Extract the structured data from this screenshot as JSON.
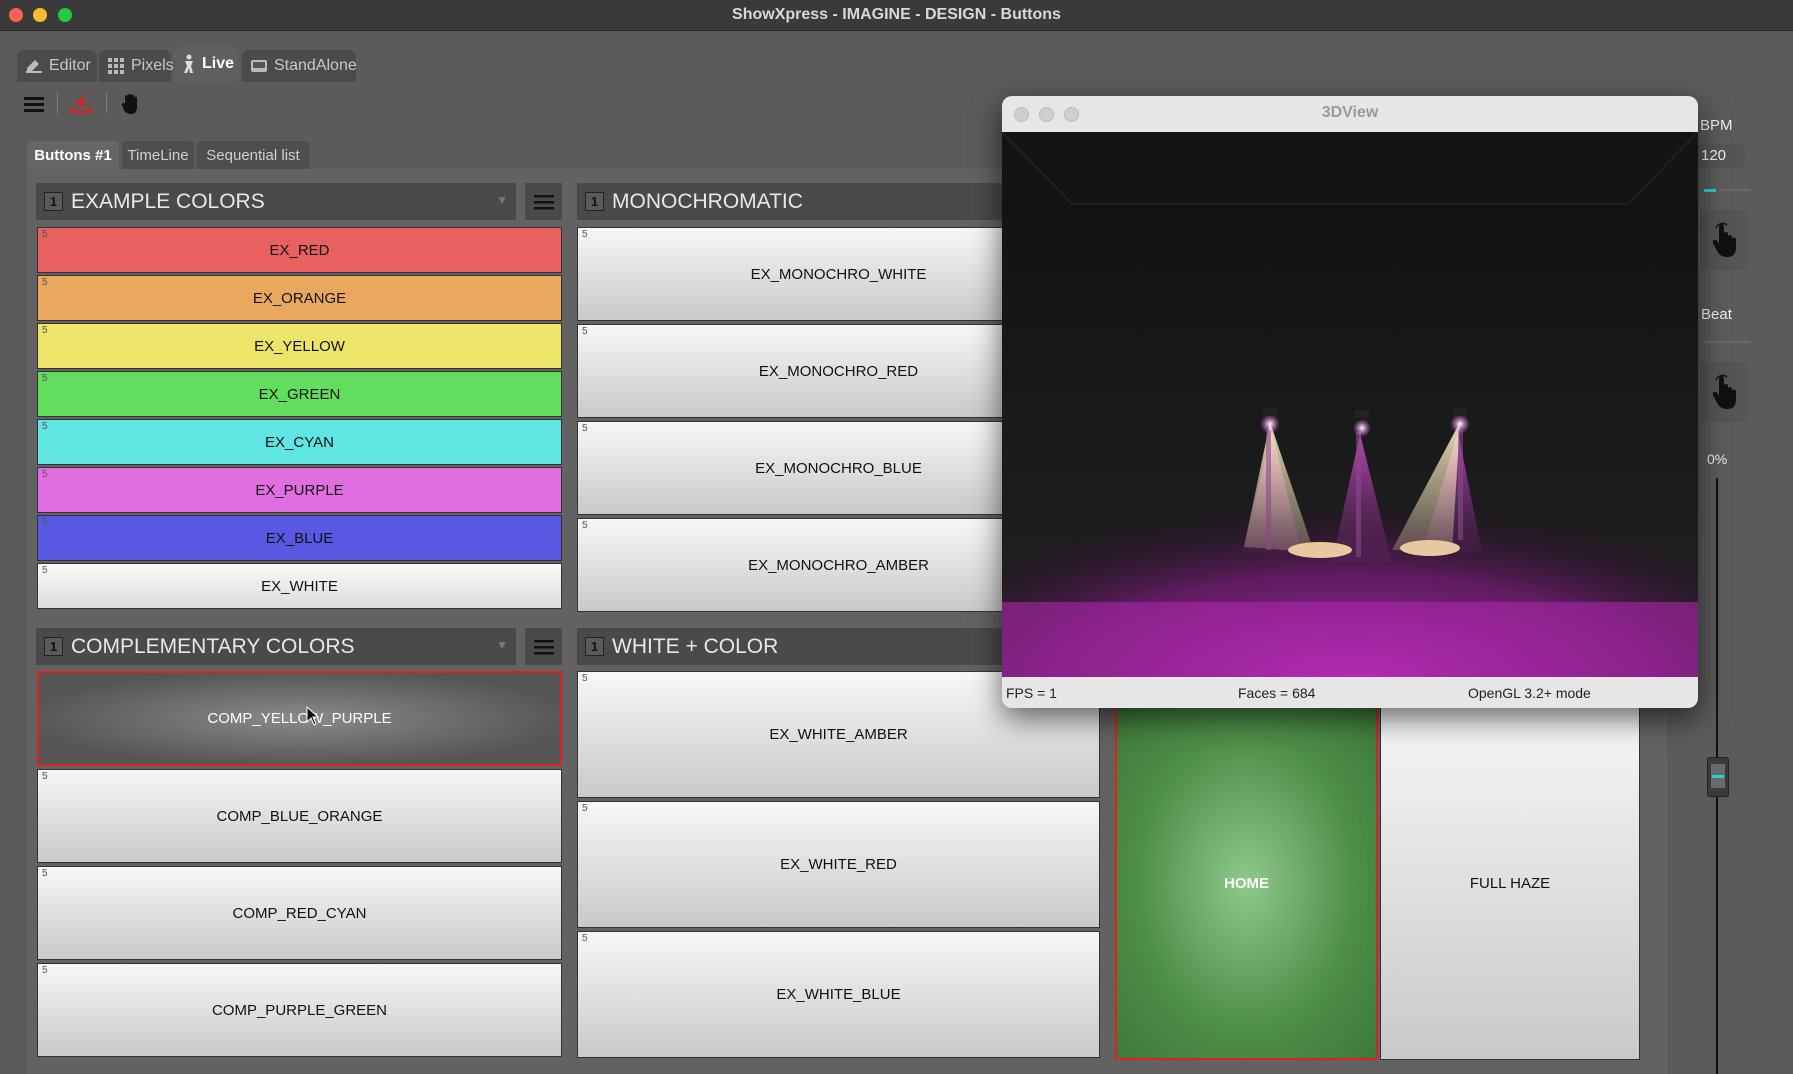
{
  "window": {
    "title": "ShowXpress - IMAGINE - DESIGN - Buttons"
  },
  "main_tabs": [
    {
      "label": "Editor"
    },
    {
      "label": "Pixels"
    },
    {
      "label": "Live"
    },
    {
      "label": "StandAlone"
    }
  ],
  "sub_tabs": [
    {
      "label": "Buttons #1"
    },
    {
      "label": "TimeLine"
    },
    {
      "label": "Sequential list"
    }
  ],
  "groups": {
    "example_colors": {
      "num": "1",
      "title": "EXAMPLE COLORS",
      "buttons": [
        {
          "label": "EX_RED",
          "color": "#e86060"
        },
        {
          "label": "EX_ORANGE",
          "color": "#e9a85e"
        },
        {
          "label": "EX_YELLOW",
          "color": "#ece56a"
        },
        {
          "label": "EX_GREEN",
          "color": "#62de5e"
        },
        {
          "label": "EX_CYAN",
          "color": "#5fe6e2"
        },
        {
          "label": "EX_PURPLE",
          "color": "#e06ee0"
        },
        {
          "label": "EX_BLUE",
          "color": "#5858e2"
        },
        {
          "label": "EX_WHITE",
          "color": "#ececec"
        }
      ]
    },
    "monochromatic": {
      "num": "1",
      "title": "MONOCHROMATIC",
      "buttons": [
        {
          "label": "EX_MONOCHRO_WHITE"
        },
        {
          "label": "EX_MONOCHRO_RED"
        },
        {
          "label": "EX_MONOCHRO_BLUE"
        },
        {
          "label": "EX_MONOCHRO_AMBER"
        }
      ]
    },
    "complementary": {
      "num": "1",
      "title": "COMPLEMENTARY COLORS",
      "buttons": [
        {
          "label": "COMP_YELLOW_PURPLE"
        },
        {
          "label": "COMP_BLUE_ORANGE"
        },
        {
          "label": "COMP_RED_CYAN"
        },
        {
          "label": "COMP_PURPLE_GREEN"
        }
      ]
    },
    "white_color": {
      "num": "1",
      "title": "WHITE + COLOR",
      "buttons": [
        {
          "label": "EX_WHITE_AMBER"
        },
        {
          "label": "EX_WHITE_RED"
        },
        {
          "label": "EX_WHITE_BLUE"
        }
      ]
    },
    "misc": {
      "buttons": [
        {
          "label": "HOME"
        },
        {
          "label": "FULL HAZE"
        }
      ]
    }
  },
  "button_corner_mark": "5",
  "right_panel": {
    "bpm_label": "BPM",
    "bpm_value": "120",
    "beat_label": "Beat",
    "percent": "0%"
  },
  "view3d": {
    "title": "3DView",
    "fps": "FPS = 1",
    "faces": "Faces = 684",
    "mode": "OpenGL 3.2+ mode"
  },
  "colors": {
    "selected_border": "#e12020",
    "home_green": "#4d8e48",
    "magenta_light": "#d040d0"
  }
}
